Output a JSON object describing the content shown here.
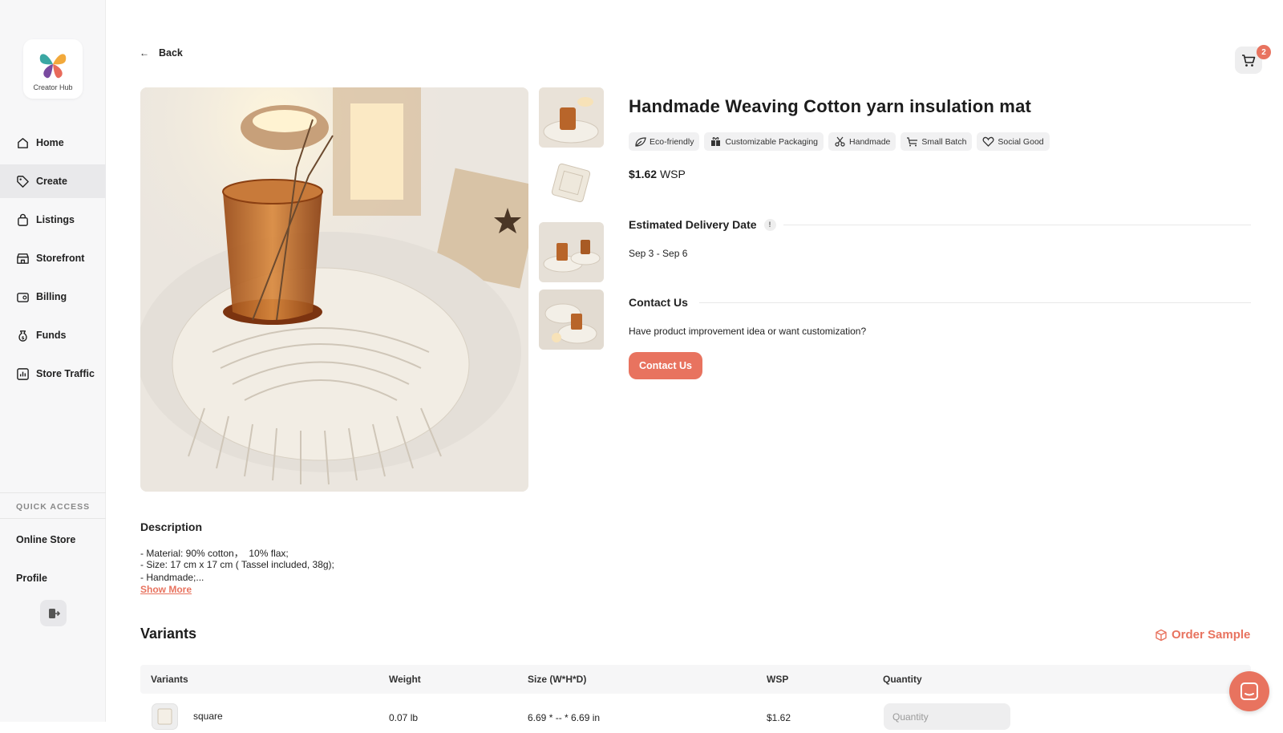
{
  "sidebar": {
    "logo_text": "Creator Hub",
    "nav": [
      {
        "label": "Home",
        "icon": "home-icon"
      },
      {
        "label": "Create",
        "icon": "tag-icon",
        "active": true
      },
      {
        "label": "Listings",
        "icon": "bag-icon"
      },
      {
        "label": "Storefront",
        "icon": "store-icon"
      },
      {
        "label": "Billing",
        "icon": "wallet-icon"
      },
      {
        "label": "Funds",
        "icon": "money-bag-icon"
      },
      {
        "label": "Store Traffic",
        "icon": "chart-icon"
      }
    ],
    "quick_access_label": "QUICK ACCESS",
    "quick_access": [
      "Online Store",
      "Profile"
    ]
  },
  "header": {
    "back_label": "Back",
    "cart_count": "2"
  },
  "product": {
    "title": "Handmade Weaving Cotton yarn insulation mat",
    "tags": [
      {
        "label": "Eco-friendly",
        "icon": "leaf-icon"
      },
      {
        "label": "Customizable Packaging",
        "icon": "gift-icon"
      },
      {
        "label": "Handmade",
        "icon": "scissors-icon"
      },
      {
        "label": "Small Batch",
        "icon": "cart-small-icon"
      },
      {
        "label": "Social Good",
        "icon": "heart-icon"
      }
    ],
    "price": "$1.62",
    "price_unit": "WSP",
    "delivery": {
      "heading": "Estimated Delivery Date",
      "info_glyph": "!",
      "range": "Sep 3 - Sep 6"
    },
    "contact": {
      "heading": "Contact Us",
      "text": "Have product improvement idea or want customization?",
      "button": "Contact Us"
    },
    "description": {
      "heading": "Description",
      "lines": [
        "- Material: 90% cotton，  10% flax;",
        "- Size: 17 cm x 17 cm ( Tassel included, 38g);",
        "- Handmade;..."
      ],
      "show_more": "Show More"
    }
  },
  "variants": {
    "heading": "Variants",
    "order_sample": "Order Sample",
    "columns": [
      "Variants",
      "Weight",
      "Size (W*H*D)",
      "WSP",
      "Quantity"
    ],
    "rows": [
      {
        "name": "square",
        "weight": "0.07 lb",
        "size": "6.69 * -- * 6.69 in",
        "wsp": "$1.62",
        "quantity_placeholder": "Quantity"
      }
    ]
  },
  "colors": {
    "accent": "#e8735f",
    "sidebar_bg": "#f7f7f8"
  }
}
